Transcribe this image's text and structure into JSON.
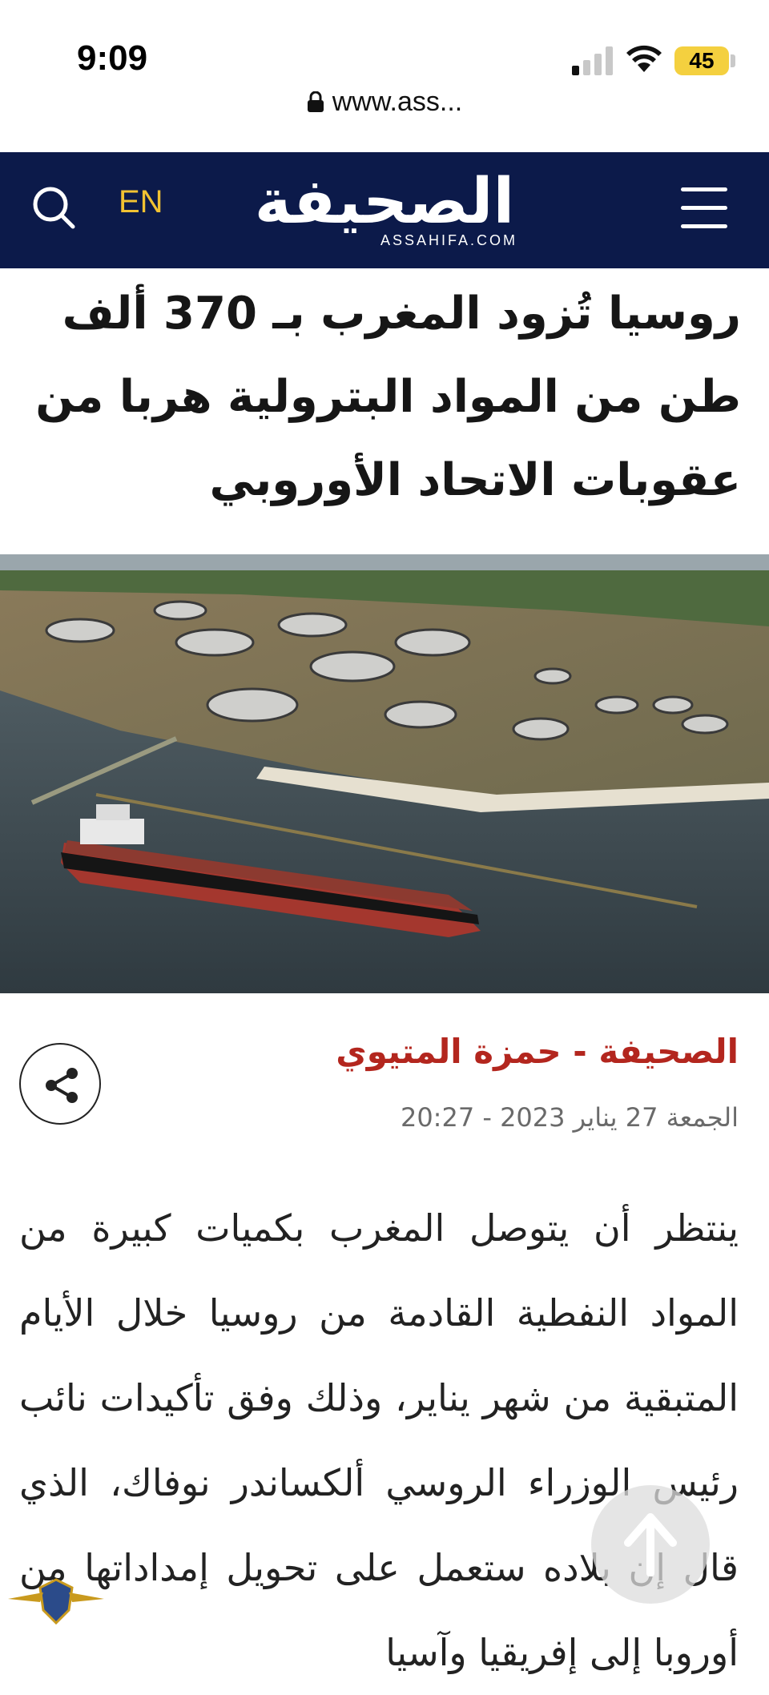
{
  "status_bar": {
    "time": "9:09",
    "battery": "45",
    "url": "www.ass..."
  },
  "header": {
    "lang_label": "EN",
    "logo_text": "الصحيفة",
    "logo_subtext": "ASSAHIFA.COM",
    "bg_color": "#0c1a4a",
    "accent_color": "#f1c232"
  },
  "article": {
    "title": "روسيا تُزود المغرب بـ 370 ألف طن من المواد البترولية هربا من عقوبات الاتحاد الأوروبي",
    "byline": "الصحيفة - حمزة المتيوي",
    "date": "الجمعة 27 يناير 2023 - 20:27",
    "body": "ينتظر أن يتوصل المغرب بكميات كبيرة من المواد النفطية القادمة من روسيا خلال الأيام المتبقية من شهر يناير، وذلك وفق تأكيدات نائب رئيس الوزراء الروسي ألكساندر نوفاك، الذي قال إن بلاده ستعمل على تحويل إمداداتها من أوروبا إلى إفريقيا وآسيا"
  },
  "icons": {
    "search": "search-icon",
    "menu": "hamburger-menu-icon",
    "share": "share-icon",
    "scroll_top": "arrow-up-icon",
    "lock": "lock-icon"
  }
}
